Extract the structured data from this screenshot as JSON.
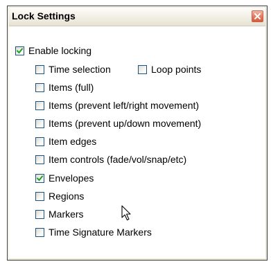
{
  "window": {
    "title": "Lock Settings"
  },
  "options": {
    "enable_locking": {
      "label": "Enable locking",
      "checked": true
    },
    "time_selection": {
      "label": "Time selection",
      "checked": false
    },
    "loop_points": {
      "label": "Loop points",
      "checked": false
    },
    "items_full": {
      "label": "Items (full)",
      "checked": false
    },
    "items_prevent_lr": {
      "label": "Items (prevent left/right movement)",
      "checked": false
    },
    "items_prevent_ud": {
      "label": "Items (prevent up/down movement)",
      "checked": false
    },
    "item_edges": {
      "label": "Item edges",
      "checked": false
    },
    "item_controls": {
      "label": "Item controls (fade/vol/snap/etc)",
      "checked": false
    },
    "envelopes": {
      "label": "Envelopes",
      "checked": true
    },
    "regions": {
      "label": "Regions",
      "checked": false
    },
    "markers": {
      "label": "Markers",
      "checked": false
    },
    "time_signature_markers": {
      "label": "Time Signature Markers",
      "checked": false
    }
  },
  "colors": {
    "check": "#21a121",
    "checkbox_border": "#1c5180",
    "close_button": "#d65c40"
  },
  "icons": {
    "close": "close-icon",
    "cursor": "mouse-pointer-icon"
  }
}
